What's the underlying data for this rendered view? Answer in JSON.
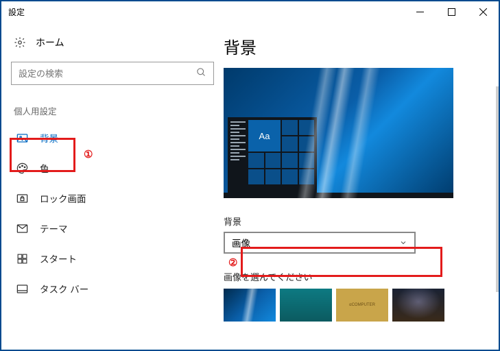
{
  "window": {
    "title": "設定"
  },
  "sidebar": {
    "home": "ホーム",
    "search_placeholder": "設定の検索",
    "section": "個人用設定",
    "items": [
      {
        "label": "背景"
      },
      {
        "label": "色"
      },
      {
        "label": "ロック画面"
      },
      {
        "label": "テーマ"
      },
      {
        "label": "スタート"
      },
      {
        "label": "タスク バー"
      }
    ]
  },
  "main": {
    "heading": "背景",
    "preview_tile_text": "Aa",
    "field_label": "背景",
    "dropdown_value": "画像",
    "choose_label": "画像を選んでください",
    "thumb3_text": "αCOMPUTER"
  },
  "callouts": {
    "one": "①",
    "two": "②"
  }
}
